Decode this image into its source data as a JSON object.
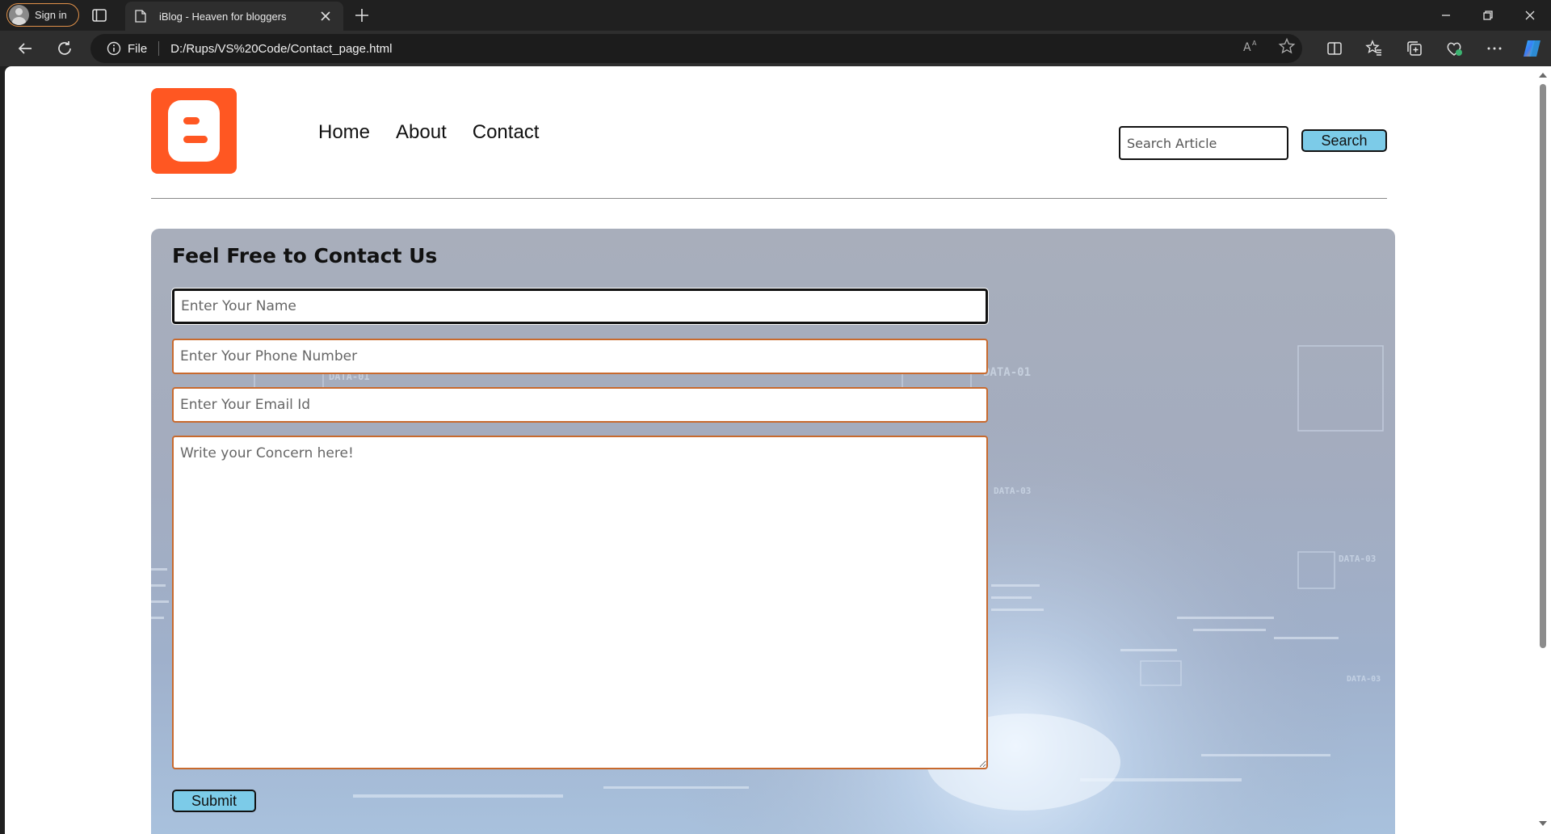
{
  "browser": {
    "signin_label": "Sign in",
    "tab_title": "iBlog - Heaven for bloggers",
    "address_scheme": "File",
    "address_url": "D:/Rups/VS%20Code/Contact_page.html"
  },
  "header": {
    "nav": [
      "Home",
      "About",
      "Contact"
    ],
    "search_placeholder": "Search Article",
    "search_button": "Search"
  },
  "contact": {
    "title": "Feel Free to Contact Us",
    "name_placeholder": "Enter Your Name",
    "phone_placeholder": "Enter Your Phone Number",
    "email_placeholder": "Enter Your Email Id",
    "concern_placeholder": "Write your Concern here!",
    "submit_label": "Submit"
  },
  "colors": {
    "logo_orange": "#ff5722",
    "button_blue": "#7ccbe8",
    "field_border": "#c86a2e"
  }
}
